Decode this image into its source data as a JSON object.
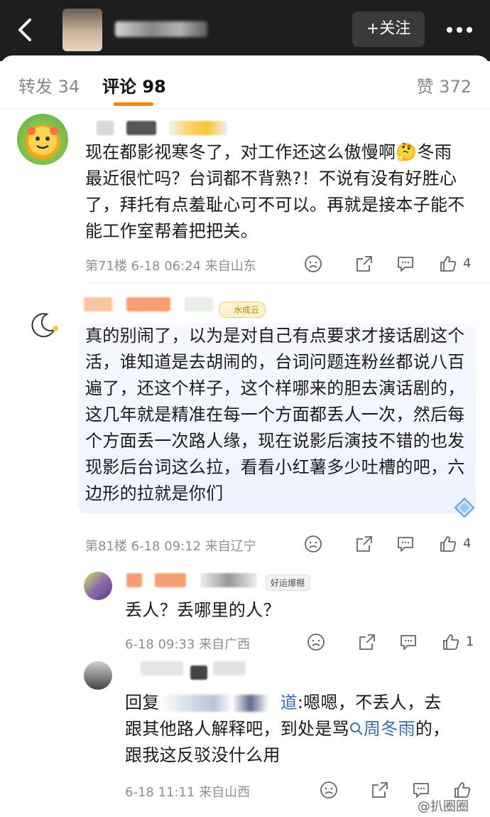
{
  "header": {
    "follow_label": "+关注"
  },
  "tabs": {
    "repost": "转发 34",
    "comment": "评论 98",
    "like": "赞 372"
  },
  "comments": [
    {
      "text": "现在都影视寒冬了，对工作还这么傲慢啊🤔冬雨最近很忙吗？台词都不背熟?！不说有没有好胜心了，拜托有点羞耻心可不可以。再就是接本子能不能工作室帮着把把关。",
      "meta": "第71楼 6-18 06:24 来自山东",
      "likes": "4"
    },
    {
      "badge": "水成云",
      "text": "真的别闹了，以为是对自己有点要求才接话剧这个活，谁知道是去胡闹的，台词问题连粉丝都说八百遍了，还这个样子，这个样哪来的胆去演话剧的，这几年就是精准在每一个方面都丢人一次，然后每个方面丢一次路人缘，现在说影后演技不错的也发现影后台词这么拉，看看小红薯多少吐槽的吧，六边形的拉就是你们",
      "meta": "第81楼 6-18 09:12 来自辽宁",
      "likes": "4"
    },
    {
      "badge": "好运爆棚",
      "text": "丢人？丢哪里的人？",
      "meta": "6-18 09:33 来自广西",
      "likes": "1"
    },
    {
      "reply_prefix": "回复",
      "reply_target_tail": "道",
      "text_a": ":嗯嗯，不丢人，去",
      "text_b": "跟其他路人解释吧，到处是骂",
      "search_term": "周冬雨",
      "text_c": "的，",
      "text_d": "跟我这反驳没什么用",
      "meta": "6-18 11:11 来自山西"
    }
  ],
  "watermark": "@扒圈圈",
  "icons": [
    "back-icon",
    "more-icon",
    "dislike-icon",
    "share-icon",
    "comment-icon",
    "like-icon",
    "search-icon",
    "diamond-icon"
  ],
  "colors": {
    "accent": "#ff8200",
    "link": "#3c6eb4",
    "topbar": "#1e1e1e"
  }
}
